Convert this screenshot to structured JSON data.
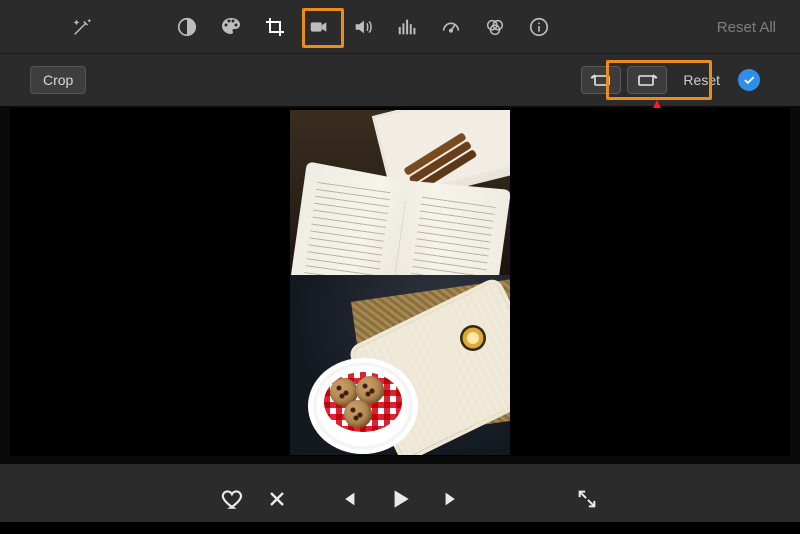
{
  "toolbar": {
    "wand_name": "auto-enhance",
    "icons": [
      {
        "name": "color-balance-icon"
      },
      {
        "name": "color-palette-icon"
      },
      {
        "name": "crop-icon",
        "selected": true
      },
      {
        "name": "camera-icon"
      },
      {
        "name": "audio-volume-icon"
      },
      {
        "name": "equalizer-icon"
      },
      {
        "name": "speed-gauge-icon"
      },
      {
        "name": "color-filters-icon"
      },
      {
        "name": "info-icon"
      }
    ],
    "reset_all_label": "Reset All"
  },
  "crop_row": {
    "crop_label": "Crop",
    "rotate_ccw_name": "rotate-counterclockwise",
    "rotate_cw_name": "rotate-clockwise",
    "reset_label": "Reset",
    "apply_name": "apply-checkmark"
  },
  "playback": {
    "favorite_name": "favorite",
    "reject_name": "reject",
    "prev_name": "previous-clip",
    "play_name": "play",
    "next_name": "next-clip",
    "fullscreen_name": "fullscreen"
  },
  "annotation": {
    "arrow_color": "#ff1a1a",
    "highlight_color": "#ed8b1c"
  }
}
